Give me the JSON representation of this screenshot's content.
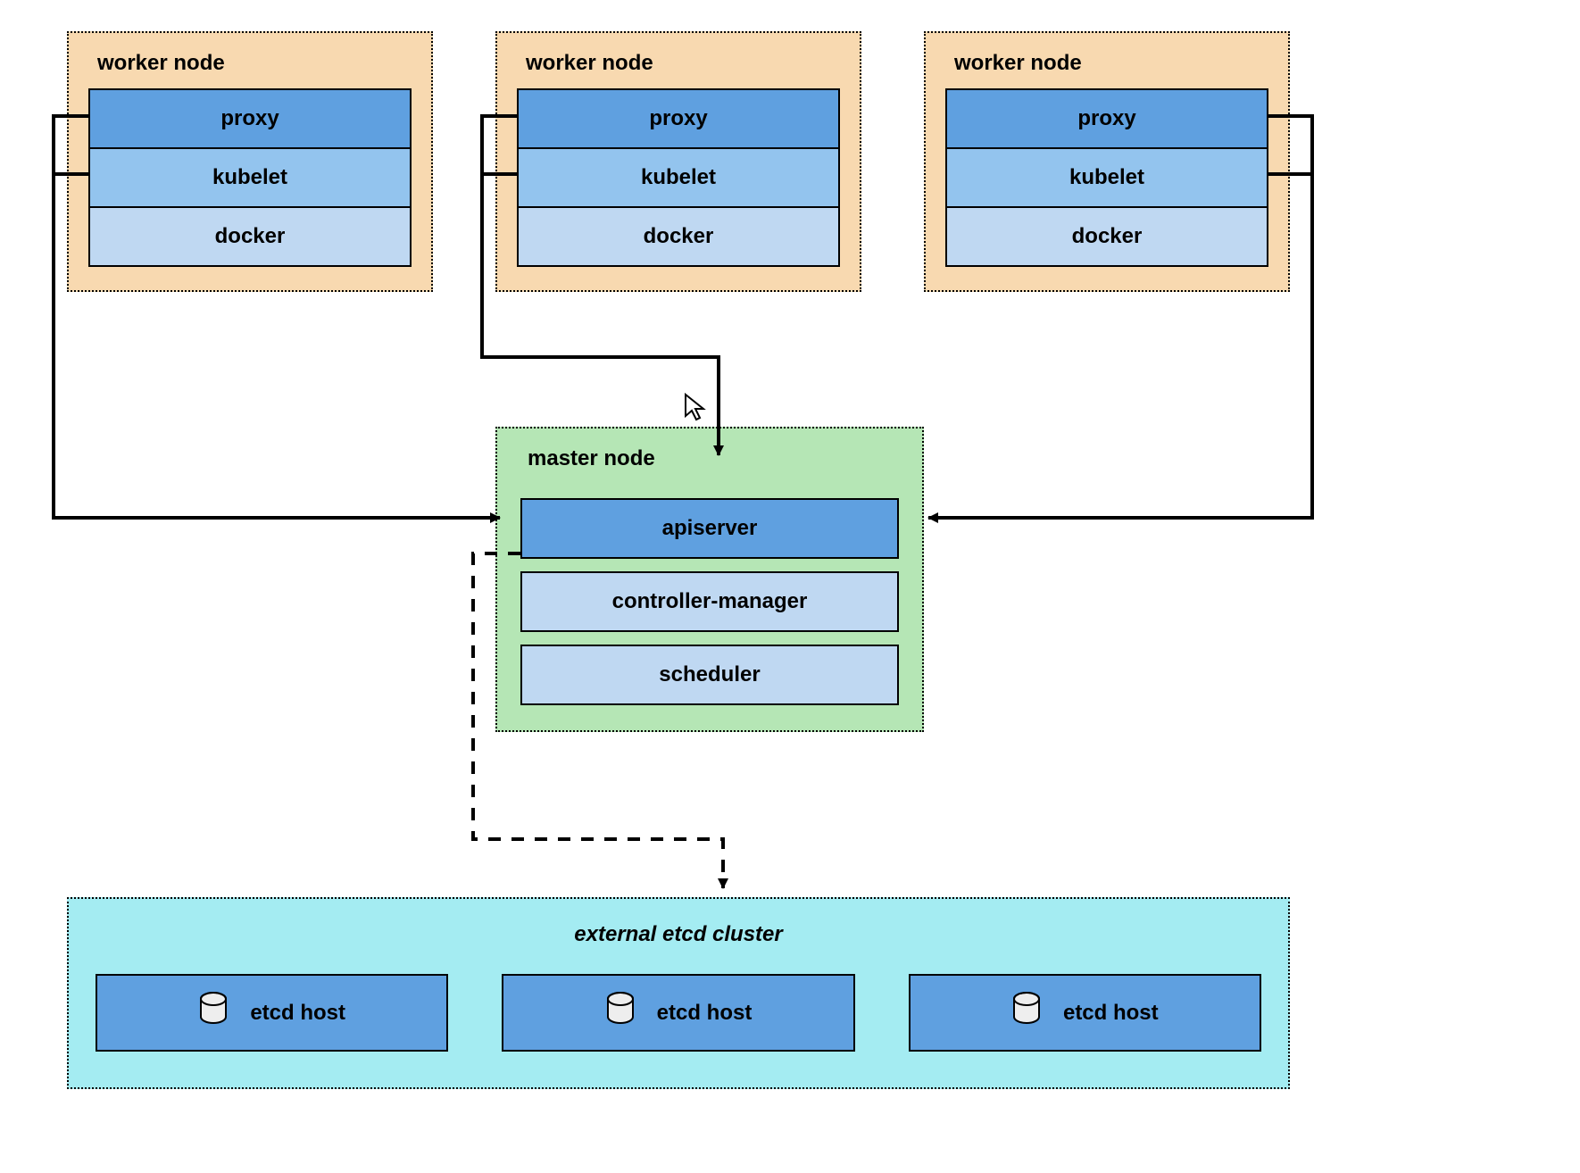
{
  "workers": [
    {
      "title": "worker node",
      "proxy": "proxy",
      "kubelet": "kubelet",
      "docker": "docker"
    },
    {
      "title": "worker node",
      "proxy": "proxy",
      "kubelet": "kubelet",
      "docker": "docker"
    },
    {
      "title": "worker node",
      "proxy": "proxy",
      "kubelet": "kubelet",
      "docker": "docker"
    }
  ],
  "master": {
    "title": "master node",
    "apiserver": "apiserver",
    "controller_manager": "controller-manager",
    "scheduler": "scheduler"
  },
  "etcd_cluster": {
    "title": "external etcd cluster",
    "hosts": [
      "etcd host",
      "etcd host",
      "etcd host"
    ]
  }
}
